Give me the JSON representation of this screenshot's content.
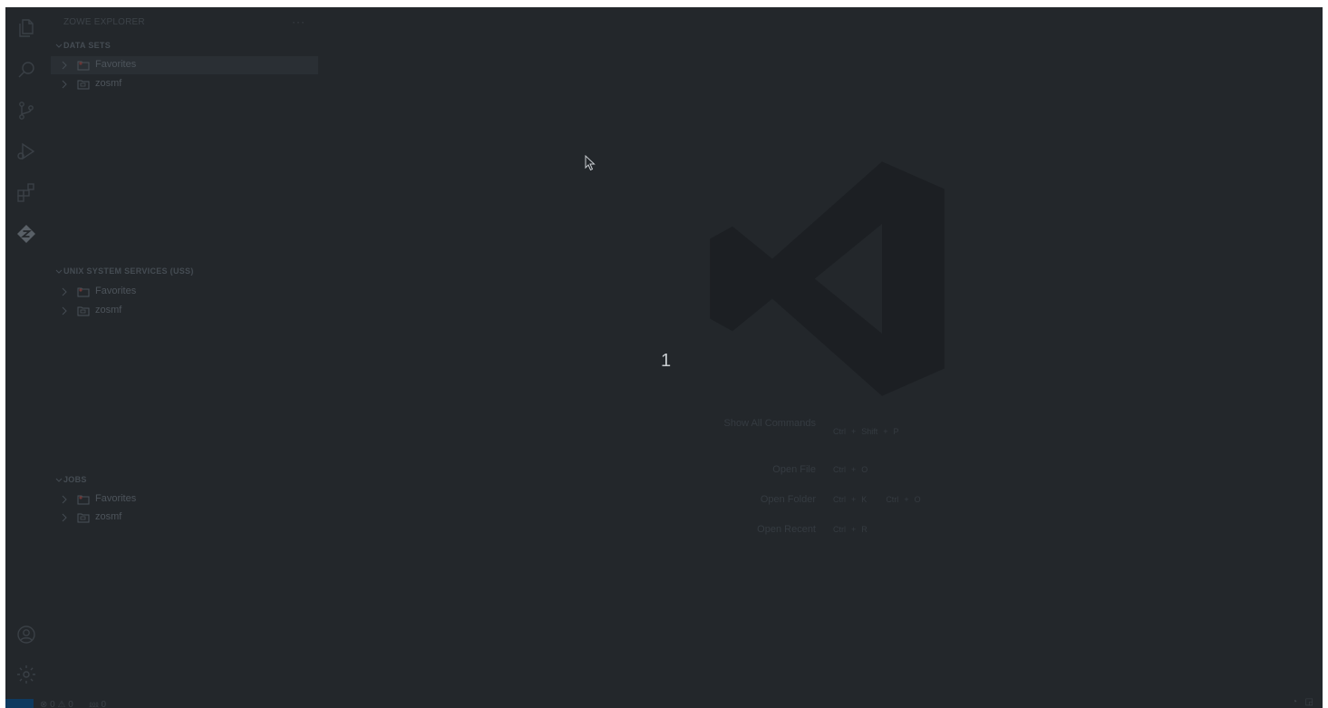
{
  "sidebar": {
    "title": "ZOWE EXPLORER",
    "more_actions": "···",
    "sections": [
      {
        "label": "DATA SETS",
        "items": [
          {
            "label": "Favorites",
            "icon": "folder-favorites-icon"
          },
          {
            "label": "zosmf",
            "icon": "folder-profile-icon"
          }
        ]
      },
      {
        "label": "UNIX SYSTEM SERVICES (USS)",
        "items": [
          {
            "label": "Favorites",
            "icon": "folder-favorites-icon"
          },
          {
            "label": "zosmf",
            "icon": "folder-profile-icon"
          }
        ]
      },
      {
        "label": "JOBS",
        "items": [
          {
            "label": "Favorites",
            "icon": "folder-favorites-icon"
          },
          {
            "label": "zosmf",
            "icon": "folder-profile-icon"
          }
        ]
      }
    ]
  },
  "editor": {
    "page_number": "1",
    "shortcuts": [
      {
        "label": "Show All Commands",
        "keys": [
          [
            "Ctrl",
            "Shift",
            "P"
          ]
        ]
      },
      {
        "label": "Open File",
        "keys": [
          [
            "Ctrl",
            "O"
          ]
        ]
      },
      {
        "label": "Open Folder",
        "keys": [
          [
            "Ctrl",
            "K"
          ],
          [
            "Ctrl",
            "O"
          ]
        ]
      },
      {
        "label": "Open Recent",
        "keys": [
          [
            "Ctrl",
            "R"
          ]
        ]
      }
    ]
  },
  "status_bar": {
    "problems": "⊗ 0 ⚠ 0",
    "ports": "⅏ 0"
  },
  "activity_bar": {
    "icons": [
      "explorer-icon",
      "search-icon",
      "source-control-icon",
      "run-debug-icon",
      "extensions-icon",
      "zowe-icon",
      "accounts-icon",
      "settings-gear-icon"
    ]
  },
  "colors": {
    "background": "#23272b",
    "remote_indicator": "#0e3a5f",
    "text_dim": "#4d545b"
  }
}
